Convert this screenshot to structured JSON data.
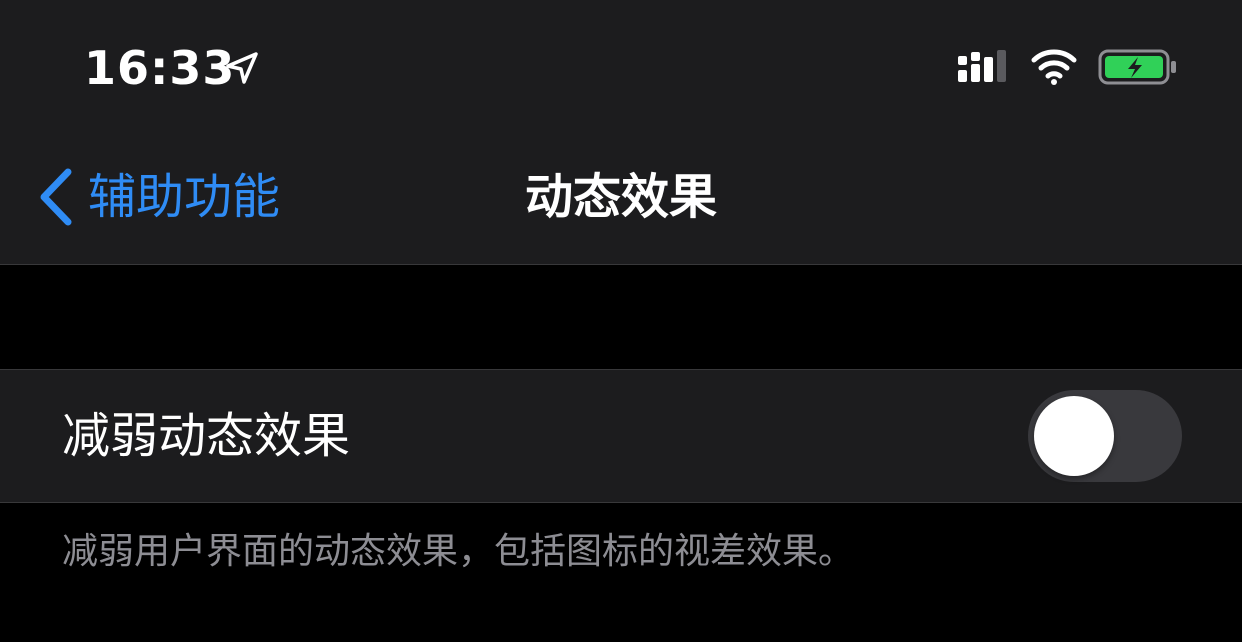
{
  "status_bar": {
    "time": "16:33",
    "icons": [
      "location-arrow-icon",
      "cellular-signal-icon",
      "wifi-icon",
      "battery-charging-icon"
    ],
    "battery_color": "#30d158"
  },
  "nav": {
    "back_label": "辅助功能",
    "title": "动态效果",
    "accent_color": "#2f8cf5"
  },
  "settings": {
    "reduce_motion": {
      "label": "减弱动态效果",
      "enabled": false
    },
    "footer": "减弱用户界面的动态效果，包括图标的视差效果。"
  }
}
